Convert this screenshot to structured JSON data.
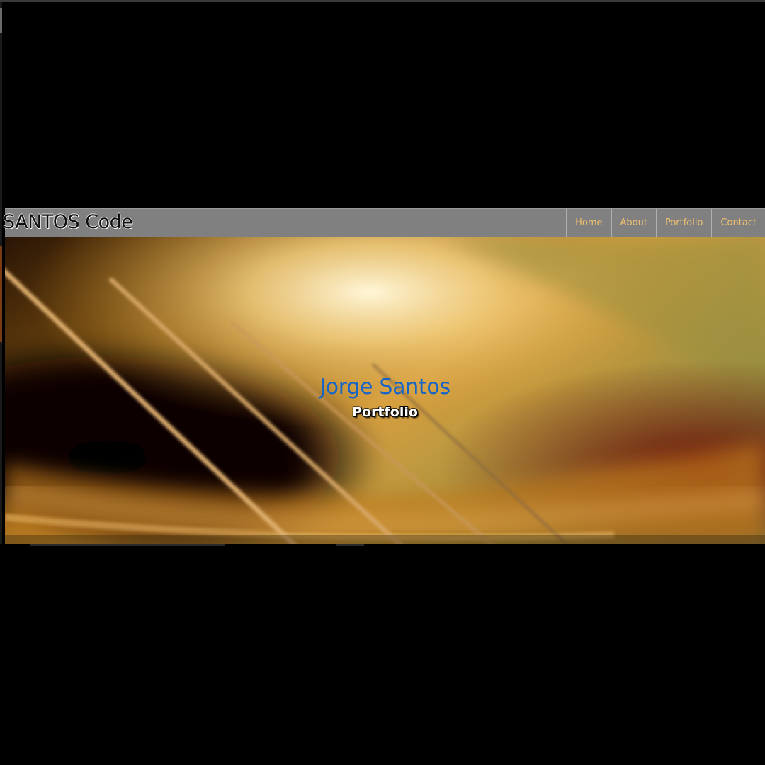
{
  "navbar": {
    "brand": "SANTOS Code",
    "links": [
      "Home",
      "About",
      "Portfolio",
      "Contact"
    ]
  },
  "hero": {
    "title": "Jorge Santos",
    "subtitle": "Portfolio",
    "image_subject": "close-up of acoustic guitar strings over sound hole"
  },
  "colors": {
    "page_background": "#000000",
    "navbar_background": "#808080",
    "nav_link_text": "#f0c070",
    "hero_title": "#1565c8",
    "hero_subtitle": "#ffffff"
  }
}
